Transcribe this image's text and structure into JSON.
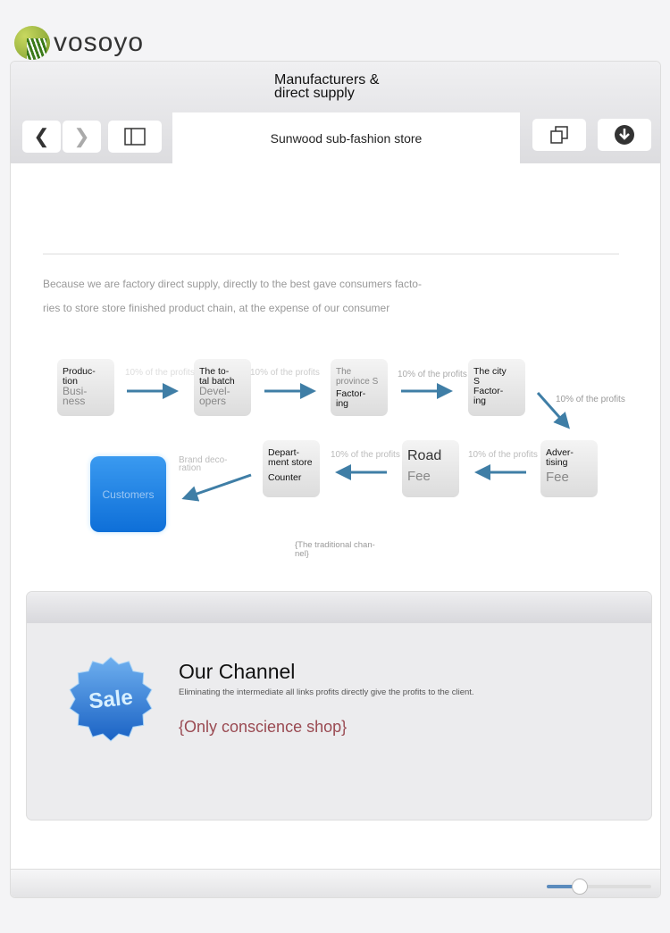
{
  "brand": {
    "name": "vosoyo"
  },
  "window": {
    "title_line1": "Manufacturers &",
    "title_line2": "direct supply",
    "url_text": "Sunwood sub-fashion store",
    "icons": {
      "back": "chevron-left-icon",
      "forward": "chevron-right-icon",
      "sidebar": "sidebar-icon",
      "tabs": "tabs-icon",
      "download": "download-icon"
    }
  },
  "intro": {
    "line1": "Because we are factory direct supply, directly to the best gave consumers facto-",
    "line2": "ries to store store finished product chain, at the expense of our consumer"
  },
  "flow": {
    "nodes": [
      {
        "l1": "Produc-",
        "l2": "tion",
        "l3": "Busi-",
        "l4": "ness"
      },
      {
        "l1": "The to-",
        "l2": "tal batch",
        "l3": "Devel-",
        "l4": "opers"
      },
      {
        "l1": "The",
        "l2": "province S",
        "l3": "Factor-",
        "l4": "ing"
      },
      {
        "l1": "The city",
        "l2": "S",
        "l3": "Factor-",
        "l4": "ing"
      },
      {
        "l1": "Adver-",
        "l2": "tising",
        "l3": "Fee"
      },
      {
        "l1": "Road",
        "l2": "Fee"
      },
      {
        "l1": "Depart-",
        "l2": "ment store",
        "l3": "Counter"
      }
    ],
    "customers": "Customers",
    "profit_label": "10% of the profits",
    "brand_deco": "Brand deco-ration",
    "caption": "{The traditional chan-nel}",
    "arrow_color": "#3f7ea6"
  },
  "channel": {
    "badge": "Sale",
    "title": "Our Channel",
    "description": "Eliminating the intermediate all links profits directly give the profits to the client.",
    "tagline": "{Only conscience shop}"
  },
  "footer": {
    "slider_value": 0.32
  }
}
